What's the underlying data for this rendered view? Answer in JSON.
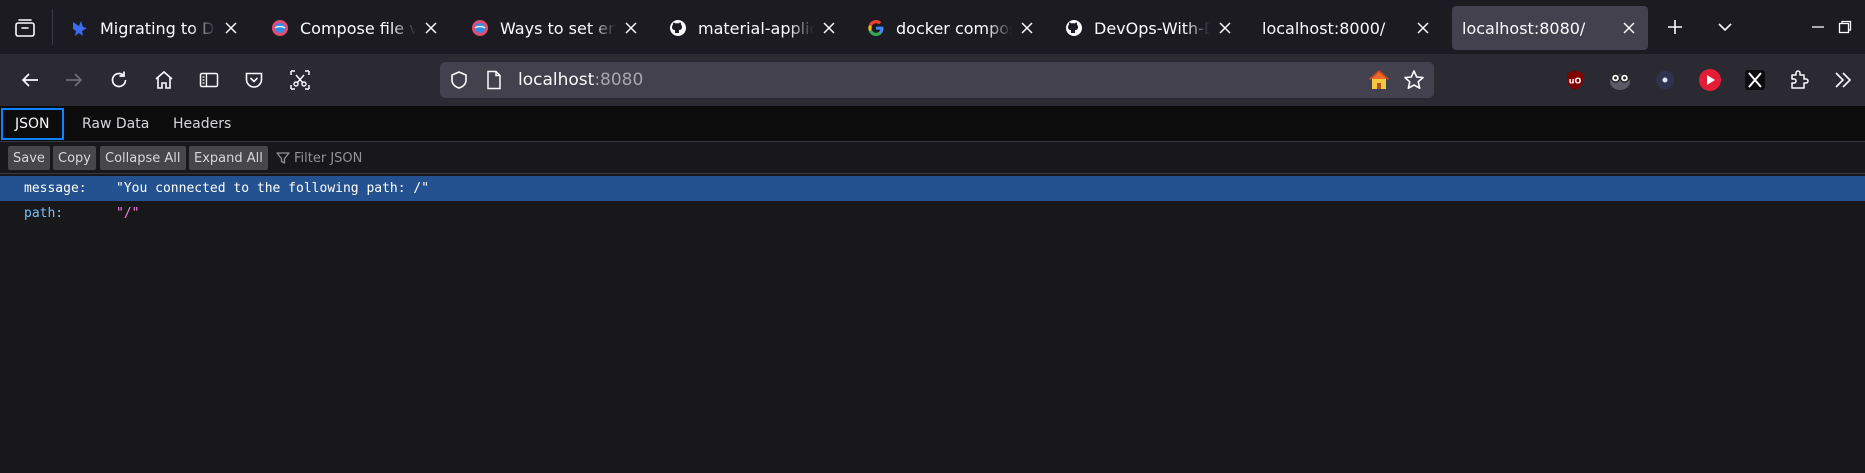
{
  "browser": {
    "tabs": [
      {
        "title": "Migrating to Docker Compose",
        "favicon": "star-bird-icon",
        "active": false
      },
      {
        "title": "Compose file versions",
        "favicon": "docker-docs-icon",
        "active": false
      },
      {
        "title": "Ways to set environment",
        "favicon": "docker-docs-icon",
        "active": false
      },
      {
        "title": "material-application",
        "favicon": "github-icon",
        "active": false
      },
      {
        "title": "docker compose",
        "favicon": "google-icon",
        "active": false
      },
      {
        "title": "DevOps-With-Docker",
        "favicon": "github-icon",
        "active": false
      },
      {
        "title": "localhost:8000/",
        "favicon": "",
        "active": false
      },
      {
        "title": "localhost:8080/",
        "favicon": "",
        "active": true
      }
    ],
    "url_host": "localhost",
    "url_port": ":8080"
  },
  "viewer": {
    "tabs": [
      "JSON",
      "Raw Data",
      "Headers"
    ],
    "toolbar": {
      "save": "Save",
      "copy": "Copy",
      "collapse_all": "Collapse All",
      "expand_all": "Expand All",
      "filter_placeholder": "Filter JSON"
    },
    "rows": [
      {
        "key": "message:",
        "value": "\"You connected to the following path: /\"",
        "selected": true
      },
      {
        "key": "path:",
        "value": "\"/\"",
        "selected": false
      }
    ]
  },
  "colors": {
    "accent": "#0a84ff",
    "selected_row": "#24518f",
    "json_key": "#75bfff",
    "json_string": "#ff7de9"
  }
}
